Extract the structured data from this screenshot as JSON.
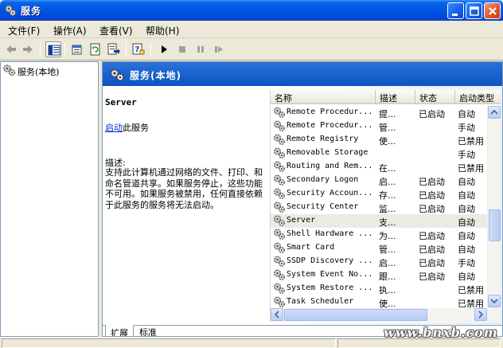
{
  "window": {
    "title": "服务"
  },
  "menu": [
    {
      "label": "文件(F)"
    },
    {
      "label": "操作(A)"
    },
    {
      "label": "查看(V)"
    },
    {
      "label": "帮助(H)"
    }
  ],
  "toolbar": {
    "icons": [
      "back-arrow-icon",
      "forward-arrow-icon",
      "show-hide-tree-icon",
      "properties-icon",
      "refresh-icon",
      "export-list-icon",
      "help-icon",
      "start-service-icon",
      "stop-service-icon",
      "pause-service-icon",
      "restart-service-icon"
    ]
  },
  "tree": {
    "root_label": "服务(本地)"
  },
  "header": {
    "title": "服务(本地)"
  },
  "details": {
    "service_name": "Server",
    "start_link": "启动",
    "start_suffix": "此服务",
    "description_label": "描述:",
    "description_text": "支持此计算机通过网络的文件、打印、和命名管道共享。如果服务停止，这些功能不可用。如果服务被禁用，任何直接依赖于此服务的服务将无法启动。"
  },
  "list": {
    "columns": [
      "名称",
      "描述",
      "状态",
      "启动类型"
    ],
    "rows": [
      {
        "name": "Remote Procedur...",
        "desc": "提...",
        "status": "已启动",
        "start": "自动"
      },
      {
        "name": "Remote Procedur...",
        "desc": "管...",
        "status": "",
        "start": "手动"
      },
      {
        "name": "Remote Registry",
        "desc": "使...",
        "status": "",
        "start": "已禁用"
      },
      {
        "name": "Removable Storage",
        "desc": "",
        "status": "",
        "start": "手动"
      },
      {
        "name": "Routing and Rem...",
        "desc": "在...",
        "status": "",
        "start": "已禁用"
      },
      {
        "name": "Secondary Logon",
        "desc": "启...",
        "status": "已启动",
        "start": "自动"
      },
      {
        "name": "Security Accoun...",
        "desc": "存...",
        "status": "已启动",
        "start": "自动"
      },
      {
        "name": "Security Center",
        "desc": "监...",
        "status": "已启动",
        "start": "自动"
      },
      {
        "name": "Server",
        "desc": "支...",
        "status": "",
        "start": "自动",
        "selected": true
      },
      {
        "name": "Shell Hardware ...",
        "desc": "为...",
        "status": "已启动",
        "start": "自动"
      },
      {
        "name": "Smart Card",
        "desc": "管...",
        "status": "已启动",
        "start": "自动"
      },
      {
        "name": "SSDP Discovery ...",
        "desc": "启...",
        "status": "已启动",
        "start": "手动"
      },
      {
        "name": "System Event No...",
        "desc": "跟...",
        "status": "已启动",
        "start": "自动"
      },
      {
        "name": "System Restore ...",
        "desc": "执...",
        "status": "",
        "start": "已禁用"
      },
      {
        "name": "Task Scheduler",
        "desc": "使...",
        "status": "",
        "start": "已禁用"
      }
    ]
  },
  "tabs": [
    {
      "label": "扩展"
    },
    {
      "label": "标准"
    }
  ],
  "watermark": "www.bnxb.com"
}
